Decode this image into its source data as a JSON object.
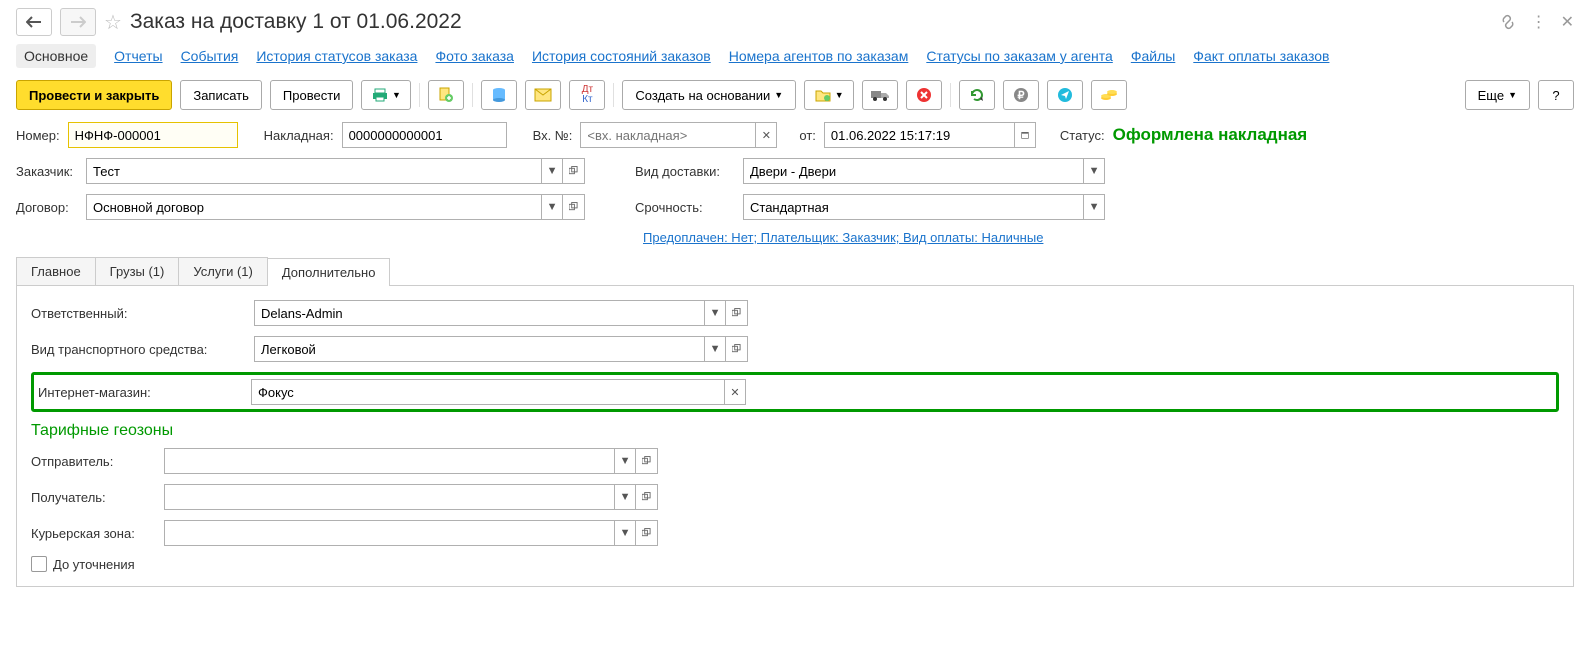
{
  "header": {
    "title": "Заказ на доставку 1 от 01.06.2022"
  },
  "nav": {
    "main": "Основное",
    "reports": "Отчеты",
    "events": "События",
    "status_history": "История статусов заказа",
    "photo": "Фото заказа",
    "state_history": "История состояний заказов",
    "agent_numbers": "Номера агентов по заказам",
    "agent_statuses": "Статусы по заказам у агента",
    "files": "Файлы",
    "payment_fact": "Факт оплаты заказов"
  },
  "toolbar": {
    "post_close": "Провести и закрыть",
    "write": "Записать",
    "post": "Провести",
    "create_based": "Создать на основании",
    "more": "Еще",
    "help": "?"
  },
  "fields": {
    "number_label": "Номер:",
    "number_value": "НФНФ-000001",
    "waybill_label": "Накладная:",
    "waybill_value": "0000000000001",
    "inbound_label": "Вх. №:",
    "inbound_placeholder": "<вх. накладная>",
    "from_label": "от:",
    "from_value": "01.06.2022 15:17:19",
    "status_label": "Статус:",
    "status_value": "Оформлена накладная",
    "customer_label": "Заказчик:",
    "customer_value": "Тест",
    "contract_label": "Договор:",
    "contract_value": "Основной договор",
    "delivery_type_label": "Вид доставки:",
    "delivery_type_value": "Двери - Двери",
    "urgency_label": "Срочность:",
    "urgency_value": "Стандартная",
    "payment_info": "Предоплачен: Нет; Плательщик: Заказчик; Вид оплаты: Наличные"
  },
  "tabs": {
    "main": "Главное",
    "cargo": "Грузы (1)",
    "services": "Услуги (1)",
    "extra": "Дополнительно"
  },
  "extra_tab": {
    "responsible_label": "Ответственный:",
    "responsible_value": "Delans-Admin",
    "vehicle_label": "Вид транспортного средства:",
    "vehicle_value": "Легковой",
    "shop_label": "Интернет-магазин:",
    "shop_value": "Фокус",
    "geozones_title": "Тарифные геозоны",
    "sender_label": "Отправитель:",
    "sender_value": "",
    "recipient_label": "Получатель:",
    "recipient_value": "",
    "courier_zone_label": "Курьерская зона:",
    "courier_zone_value": "",
    "until_clarification": "До уточнения"
  }
}
